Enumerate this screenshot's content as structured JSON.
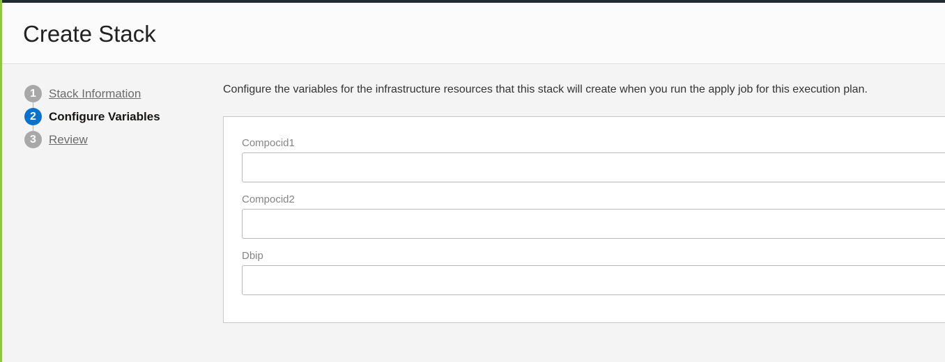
{
  "header": {
    "title": "Create Stack"
  },
  "steps": [
    {
      "number": "1",
      "label": "Stack Information",
      "state": "link"
    },
    {
      "number": "2",
      "label": "Configure Variables",
      "state": "active"
    },
    {
      "number": "3",
      "label": "Review",
      "state": "link"
    }
  ],
  "main": {
    "intro": "Configure the variables for the infrastructure resources that this stack will create when you run the apply job for this execution plan.",
    "fields": [
      {
        "label": "Compocid1",
        "value": ""
      },
      {
        "label": "Compocid2",
        "value": ""
      },
      {
        "label": "Dbip",
        "value": ""
      }
    ]
  },
  "colors": {
    "accent": "#0572ce",
    "left_border": "#8dc63f",
    "top_bar": "#1f2a31"
  }
}
